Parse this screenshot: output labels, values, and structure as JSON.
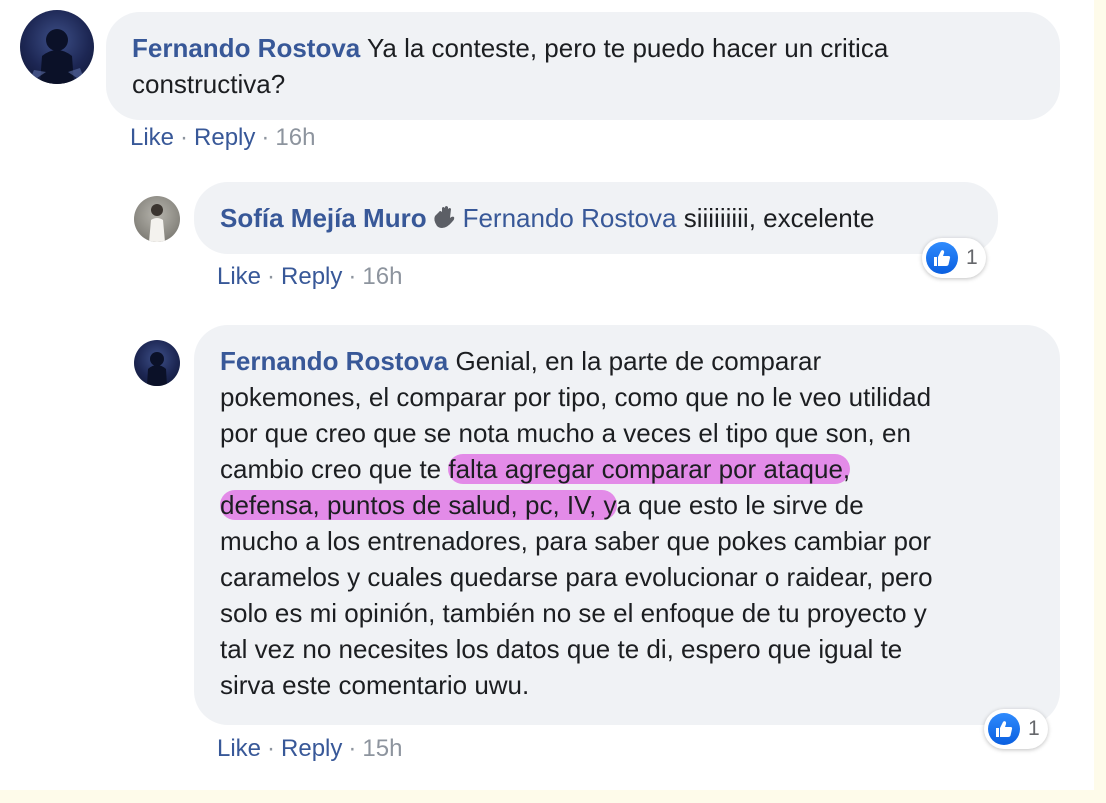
{
  "comments": [
    {
      "author": "Fernando Rostova",
      "text_line1": " Ya la conteste, pero te puedo hacer un critica",
      "text_line2": "constructiva?",
      "actions": {
        "like": "Like",
        "reply": "Reply",
        "time": "16h"
      }
    },
    {
      "author": "Sofía Mejía Muro",
      "mention": "Fernando Rostova",
      "text": " siiiiiiiii, excelente",
      "reaction_count": "1",
      "actions": {
        "like": "Like",
        "reply": "Reply",
        "time": "16h"
      }
    },
    {
      "author": "Fernando Rostova",
      "line1": " Genial, en la parte de comparar",
      "line2": "pokemones, el comparar por tipo, como que no le veo utilidad",
      "line3": "por que creo que se nota mucho a veces el tipo que son, en",
      "line4_a": "cambio creo que te ",
      "line4_hl": "falta agregar comparar por ataque,",
      "line5_hl": "defensa, puntos de salud, pc, IV, y",
      "line5_b": "a que esto le sirve de",
      "line6": "mucho a los entrenadores, para saber que pokes cambiar por",
      "line7": "caramelos y cuales quedarse para evolucionar o raidear, pero",
      "line8": "solo es mi opinión, también no se el enfoque de tu proyecto y",
      "line9": "tal vez no necesites los datos que te di, espero que igual te",
      "line10": "sirva este comentario uwu.",
      "reaction_count": "1",
      "actions": {
        "like": "Like",
        "reply": "Reply",
        "time": "15h"
      }
    }
  ],
  "separator": "·",
  "icons": {
    "reaction": "like-icon",
    "wave": "waving-hand-icon"
  },
  "colors": {
    "author": "#385898",
    "bubble": "#f0f2f5",
    "highlight": "#e38be8",
    "like_blue": "#1877f2"
  }
}
